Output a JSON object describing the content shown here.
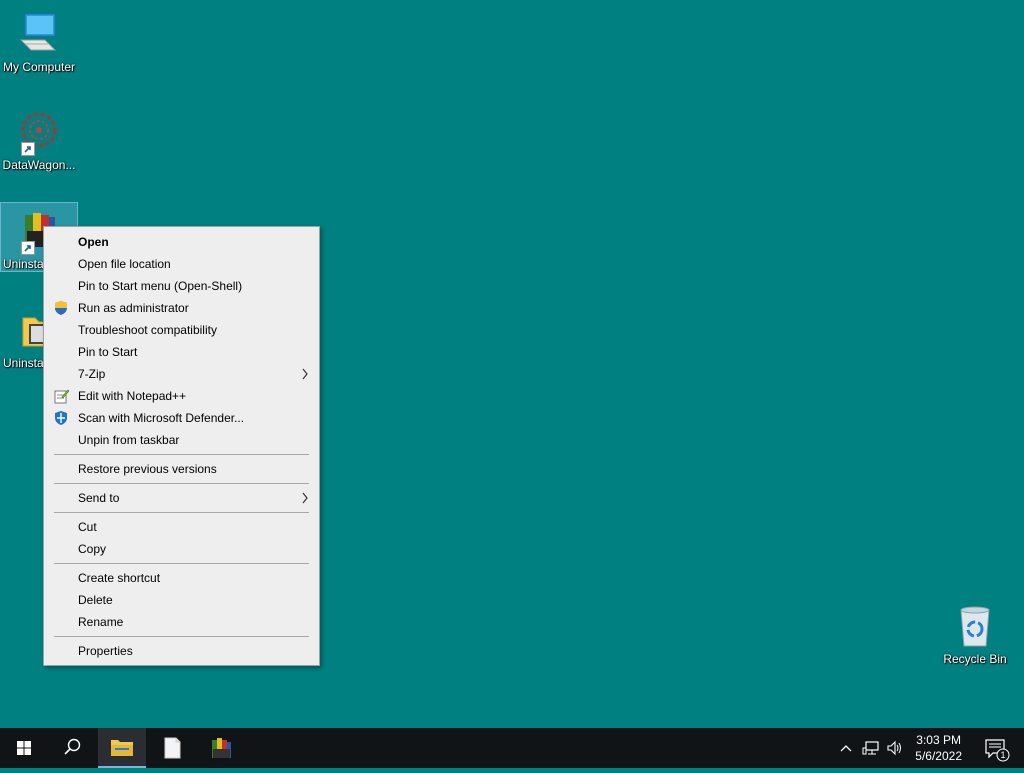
{
  "desktop": {
    "icons": [
      {
        "label": "My Computer"
      },
      {
        "label": "DataWagon..."
      },
      {
        "label": "Uninsta"
      },
      {
        "label": "Uninsta"
      },
      {
        "label": "Recycle Bin"
      }
    ]
  },
  "context_menu": {
    "items": [
      {
        "label": "Open"
      },
      {
        "label": "Open file location"
      },
      {
        "label": "Pin to Start menu (Open-Shell)"
      },
      {
        "label": "Run as administrator",
        "icon": "uac-shield-icon"
      },
      {
        "label": "Troubleshoot compatibility"
      },
      {
        "label": "Pin to Start"
      },
      {
        "label": "7-Zip"
      },
      {
        "label": "Edit with Notepad++",
        "icon": "notepadpp-icon"
      },
      {
        "label": "Scan with Microsoft Defender...",
        "icon": "defender-icon"
      },
      {
        "label": "Unpin from taskbar"
      },
      {
        "label": "Restore previous versions"
      },
      {
        "label": "Send to"
      },
      {
        "label": "Cut"
      },
      {
        "label": "Copy"
      },
      {
        "label": "Create shortcut"
      },
      {
        "label": "Delete"
      },
      {
        "label": "Rename"
      },
      {
        "label": "Properties"
      }
    ]
  },
  "taskbar": {
    "time": "3:03 PM",
    "date": "5/6/2022",
    "notification_count": "1"
  },
  "colors": {
    "desktop_bg": "#008080",
    "menu_bg": "#eeeeee",
    "taskbar_bg": "#101417"
  }
}
